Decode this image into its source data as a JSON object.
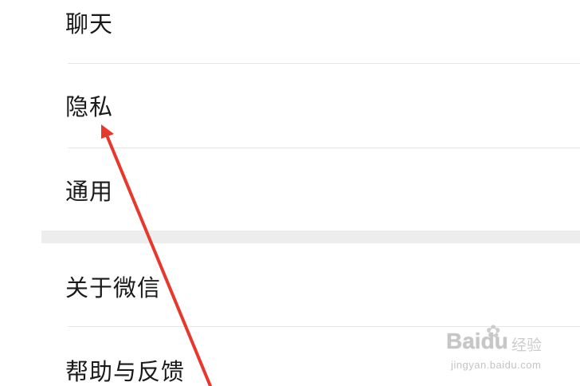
{
  "settings": {
    "items": [
      {
        "label": "聊天"
      },
      {
        "label": "隐私"
      },
      {
        "label": "通用"
      },
      {
        "label": "关于微信"
      },
      {
        "label": "帮助与反馈"
      }
    ]
  },
  "watermark": {
    "logo": "Baidu",
    "sub": "经验",
    "url": "jingyan.baidu.com"
  },
  "annotation": {
    "icon": "red-arrow-icon",
    "color": "#e8382e",
    "points_to": "隐私"
  }
}
